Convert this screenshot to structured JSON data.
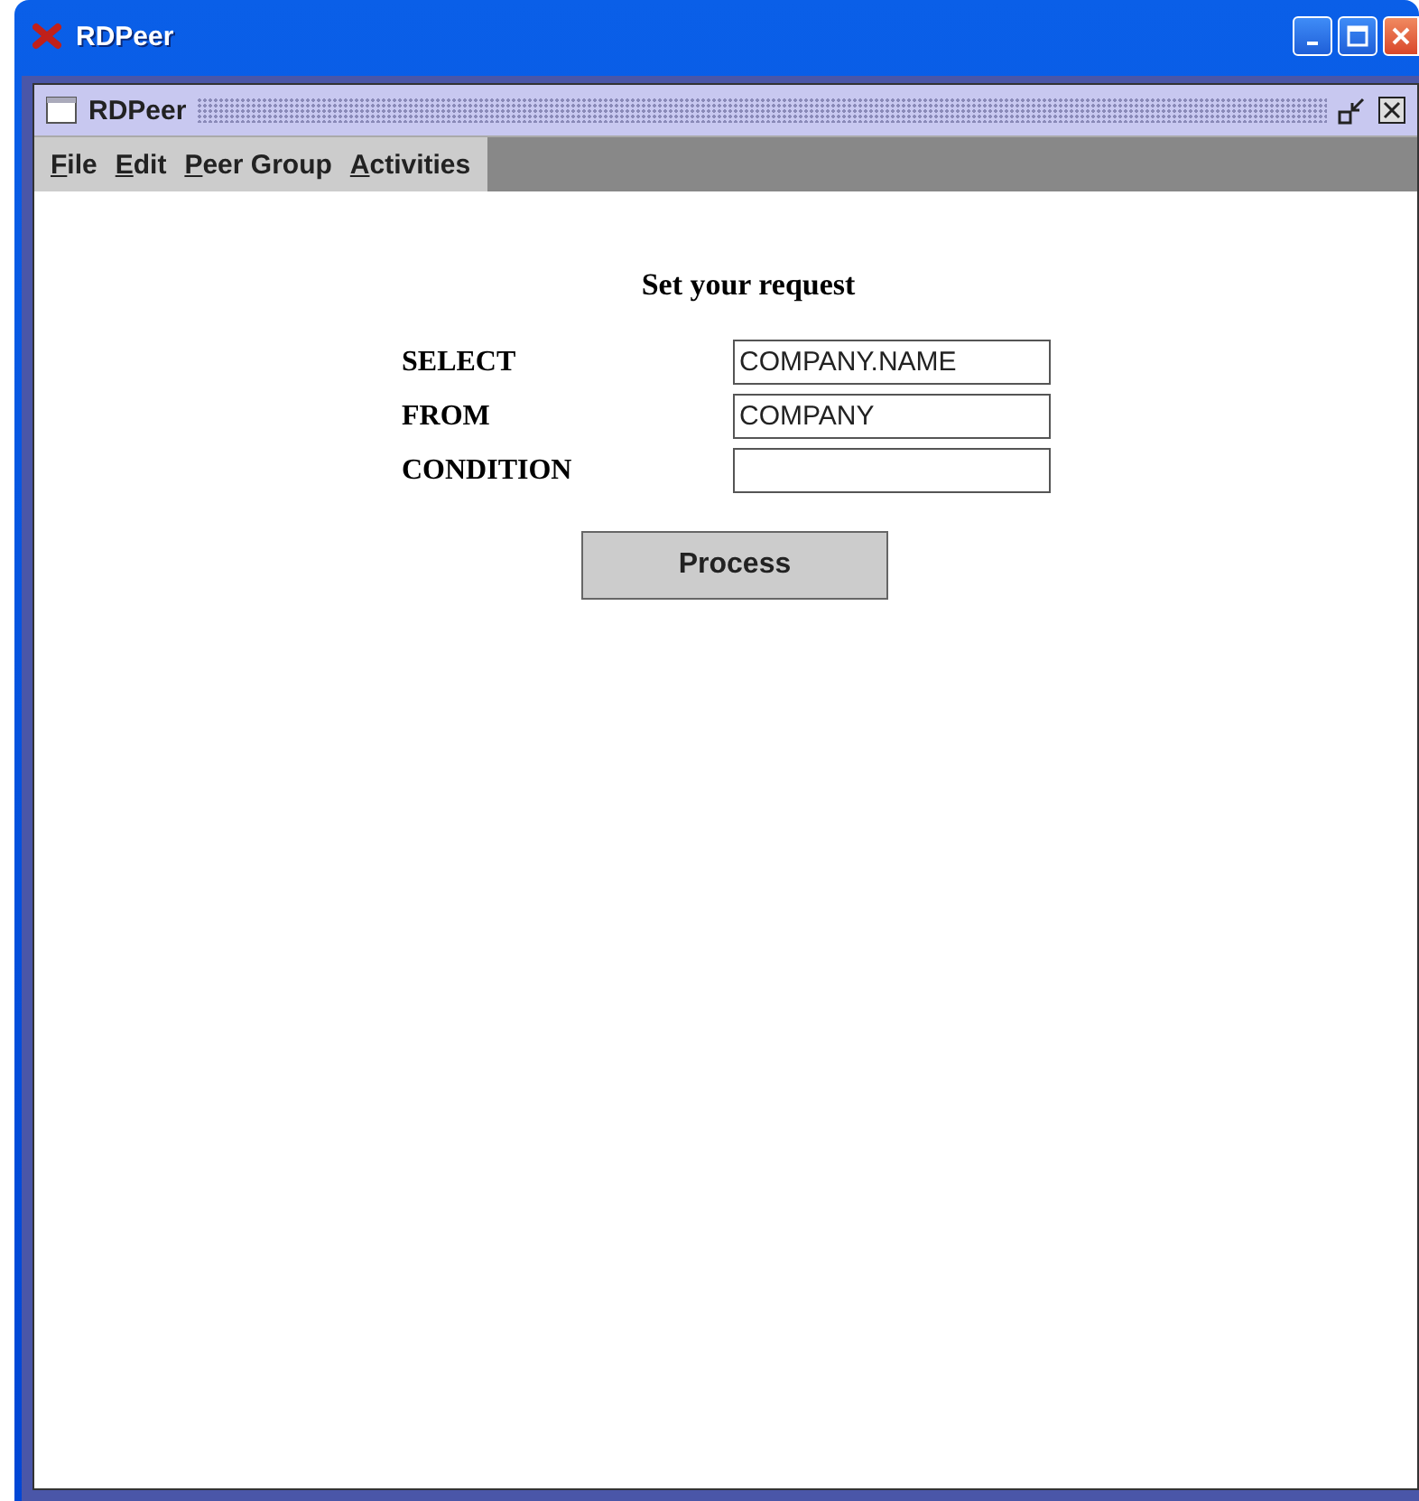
{
  "window": {
    "title": "RDPeer"
  },
  "internal_frame": {
    "title": "RDPeer"
  },
  "menu": [
    "File",
    "Edit",
    "Peer Group",
    "Activities"
  ],
  "form": {
    "heading": "Set your request",
    "fields": [
      {
        "label": "SELECT",
        "value": "COMPANY.NAME"
      },
      {
        "label": "FROM",
        "value": "COMPANY"
      },
      {
        "label": "CONDITION"
      }
    ],
    "button": "Process"
  }
}
